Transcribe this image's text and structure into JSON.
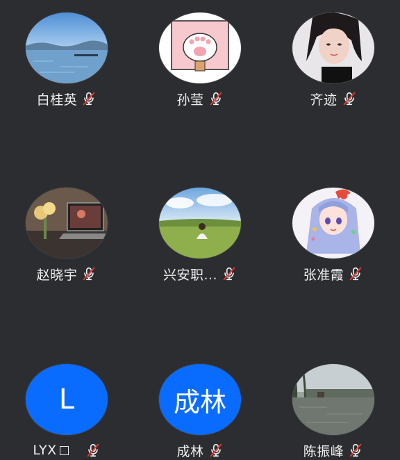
{
  "participants": [
    {
      "name": "白桂英",
      "avatar": "lake-photo",
      "muted": true
    },
    {
      "name": "孙莹",
      "avatar": "cat-paw-cartoon",
      "muted": true
    },
    {
      "name": "齐迹",
      "avatar": "woman-portrait",
      "muted": true
    },
    {
      "name": "赵晓宇",
      "avatar": "laptop-desk-photo",
      "muted": true
    },
    {
      "name": "兴安职...",
      "avatar": "grassland-photo",
      "muted": true
    },
    {
      "name": "张准霞",
      "avatar": "anime-girl",
      "muted": true
    },
    {
      "name": "LYX",
      "avatar_letter": "L",
      "muted": true
    },
    {
      "name": "成林",
      "avatar_letter": "成林",
      "muted": true
    },
    {
      "name": "陈振峰",
      "avatar": "river-photo",
      "muted": true
    }
  ],
  "colors": {
    "background": "#2b2d30",
    "letter_avatar": "#0a6cff",
    "mute_slash": "#e53935",
    "name_text": "#f0f0f0"
  }
}
